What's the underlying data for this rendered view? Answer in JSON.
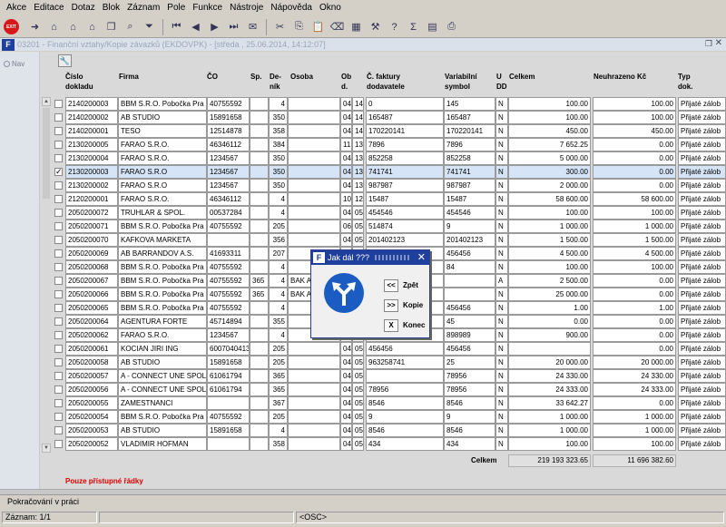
{
  "menu": [
    "Akce",
    "Editace",
    "Dotaz",
    "Blok",
    "Záznam",
    "Pole",
    "Funkce",
    "Nástroje",
    "Nápověda",
    "Okno"
  ],
  "toolbar": {
    "exit_label": "EXIT"
  },
  "window": {
    "title": "03201 - Finanční vztahy/Kopie závazků (EKDOVPK) - [středa , 25.06.2014, 14:12:07]"
  },
  "nav": {
    "label": "Nav"
  },
  "columns": {
    "cislo": [
      "Číslo",
      "dokladu"
    ],
    "firma": "Firma",
    "co": "ČO",
    "sp": "Sp.",
    "denik": [
      "De-",
      "ník"
    ],
    "osoba": "Osoba",
    "obd": [
      "Ob",
      "d."
    ],
    "faktura": [
      "Č. faktury",
      "dodavatele"
    ],
    "vs": [
      "Variabilní",
      "symbol"
    ],
    "udd": [
      "U",
      "DD"
    ],
    "celkem": "Celkem",
    "neuhrazeno": "Neuhrazeno Kč",
    "typ": [
      "Typ",
      "dok."
    ]
  },
  "rows": [
    {
      "c": "2140200003",
      "f": "BBM S.R.O. Pobočka Pra",
      "ico": "40755592",
      "sp": "",
      "d": "4",
      "o": "",
      "m": "04",
      "y": "14",
      "fak": "0",
      "vs": "145",
      "u": "N",
      "cel": "100.00",
      "neu": "100.00",
      "t": "Přijaté zálob"
    },
    {
      "c": "2140200002",
      "f": "AB STUDIO",
      "ico": "15891658",
      "sp": "",
      "d": "350",
      "o": "",
      "m": "04",
      "y": "14",
      "fak": "165487",
      "vs": "165487",
      "u": "N",
      "cel": "100.00",
      "neu": "100.00",
      "t": "Přijaté zálob"
    },
    {
      "c": "2140200001",
      "f": "TESO",
      "ico": "12514878",
      "sp": "",
      "d": "358",
      "o": "",
      "m": "04",
      "y": "14",
      "fak": "170220141",
      "vs": "170220141",
      "u": "N",
      "cel": "450.00",
      "neu": "450.00",
      "t": "Přijaté zálob"
    },
    {
      "c": "2130200005",
      "f": "FARAO S.R.O.",
      "ico": "46346112",
      "sp": "",
      "d": "384",
      "o": "",
      "m": "11",
      "y": "13",
      "fak": "7896",
      "vs": "7896",
      "u": "N",
      "cel": "7 652.25",
      "neu": "0.00",
      "t": "Přijaté zálob"
    },
    {
      "c": "2130200004",
      "f": "FARAO S.R.O.",
      "ico": "1234567",
      "sp": "",
      "d": "350",
      "o": "",
      "m": "04",
      "y": "13",
      "fak": "852258",
      "vs": "852258",
      "u": "N",
      "cel": "5 000.00",
      "neu": "0.00",
      "t": "Přijaté zálob"
    },
    {
      "c": "2130200003",
      "f": "FARAO S.R.O",
      "ico": "1234567",
      "sp": "",
      "d": "350",
      "o": "",
      "m": "04",
      "y": "13",
      "fak": "741741",
      "vs": "741741",
      "u": "N",
      "cel": "300.00",
      "neu": "0.00",
      "t": "Přijaté zálob",
      "sel": true
    },
    {
      "c": "2130200002",
      "f": "FARAO S.R.O",
      "ico": "1234567",
      "sp": "",
      "d": "350",
      "o": "",
      "m": "04",
      "y": "13",
      "fak": "987987",
      "vs": "987987",
      "u": "N",
      "cel": "2 000.00",
      "neu": "0.00",
      "t": "Přijaté zálob"
    },
    {
      "c": "2120200001",
      "f": "FARAO S.R.O.",
      "ico": "46346112",
      "sp": "",
      "d": "4",
      "o": "",
      "m": "10",
      "y": "12",
      "fak": "15487",
      "vs": "15487",
      "u": "N",
      "cel": "58 600.00",
      "neu": "58 600.00",
      "t": "Přijaté zálob"
    },
    {
      "c": "2050200072",
      "f": "TRUHLAR & SPOL.",
      "ico": "00537284",
      "sp": "",
      "d": "4",
      "o": "",
      "m": "04",
      "y": "05",
      "fak": "454546",
      "vs": "454546",
      "u": "N",
      "cel": "100.00",
      "neu": "100.00",
      "t": "Přijaté zálob"
    },
    {
      "c": "2050200071",
      "f": "BBM S.R.O. Pobočka Pra",
      "ico": "40755592",
      "sp": "",
      "d": "205",
      "o": "",
      "m": "06",
      "y": "05",
      "fak": "514874",
      "vs": "9",
      "u": "N",
      "cel": "1 000.00",
      "neu": "1 000.00",
      "t": "Přijaté zálob"
    },
    {
      "c": "2050200070",
      "f": "KAFKOVA MARKETA",
      "ico": "",
      "sp": "",
      "d": "356",
      "o": "",
      "m": "04",
      "y": "05",
      "fak": "201402123",
      "vs": "201402123",
      "u": "N",
      "cel": "1 500.00",
      "neu": "1 500.00",
      "t": "Přijaté zálob"
    },
    {
      "c": "2050200069",
      "f": "AB BARRANDOV A.S.",
      "ico": "41693311",
      "sp": "",
      "d": "207",
      "o": "",
      "m": "",
      "y": "",
      "fak": "",
      "vs": "456456",
      "u": "N",
      "cel": "4 500.00",
      "neu": "4 500.00",
      "t": "Přijaté zálob"
    },
    {
      "c": "2050200068",
      "f": "BBM S.R.O. Pobočka Pra",
      "ico": "40755592",
      "sp": "",
      "d": "4",
      "o": "",
      "m": "",
      "y": "",
      "fak": "",
      "vs": "84",
      "u": "N",
      "cel": "100.00",
      "neu": "100.00",
      "t": "Přijaté zálob"
    },
    {
      "c": "2050200067",
      "f": "BBM S.R.O. Pobočka Pra",
      "ico": "40755592",
      "sp": "365",
      "d": "4",
      "o": "BAK A",
      "m": "",
      "y": "",
      "fak": "",
      "vs": "",
      "u": "A",
      "cel": "2 500.00",
      "neu": "0.00",
      "t": "Přijaté zálob"
    },
    {
      "c": "2050200066",
      "f": "BBM S.R.O. Pobočka Pra",
      "ico": "40755592",
      "sp": "365",
      "d": "4",
      "o": "BAK A",
      "m": "",
      "y": "",
      "fak": "",
      "vs": "",
      "u": "N",
      "cel": "25 000.00",
      "neu": "0.00",
      "t": "Přijaté zálob"
    },
    {
      "c": "2050200065",
      "f": "BBM S.R.O. Pobočka Pra",
      "ico": "40755592",
      "sp": "",
      "d": "4",
      "o": "",
      "m": "",
      "y": "",
      "fak": "",
      "vs": "456456",
      "u": "N",
      "cel": "1.00",
      "neu": "1.00",
      "t": "Přijaté zálob"
    },
    {
      "c": "2050200064",
      "f": "AGENTURA FORTE",
      "ico": "45714894",
      "sp": "",
      "d": "355",
      "o": "",
      "m": "",
      "y": "",
      "fak": "",
      "vs": "45",
      "u": "N",
      "cel": "0.00",
      "neu": "0.00",
      "t": "Přijaté zálob"
    },
    {
      "c": "2050200062",
      "f": "FARAO S.R.O.",
      "ico": "1234567",
      "sp": "",
      "d": "4",
      "o": "",
      "m": "",
      "y": "",
      "fak": "",
      "vs": "898989",
      "u": "N",
      "cel": "900.00",
      "neu": "0.00",
      "t": "Přijaté zálob"
    },
    {
      "c": "2050200061",
      "f": "KOCIAN JIRI ING",
      "ico": "6007040413",
      "sp": "",
      "d": "205",
      "o": "",
      "m": "04",
      "y": "05",
      "fak": "456456",
      "vs": "456456",
      "u": "N",
      "cel": "",
      "neu": "0.00",
      "t": "Přijaté zálob"
    },
    {
      "c": "2050200058",
      "f": "AB STUDIO",
      "ico": "15891658",
      "sp": "",
      "d": "205",
      "o": "",
      "m": "04",
      "y": "05",
      "fak": "963258741",
      "vs": "25",
      "u": "N",
      "cel": "20 000.00",
      "neu": "20 000.00",
      "t": "Přijaté zálob"
    },
    {
      "c": "2050200057",
      "f": "A - CONNECT UNE SPOL",
      "ico": "61061794",
      "sp": "",
      "d": "365",
      "o": "",
      "m": "04",
      "y": "05",
      "fak": "",
      "vs": "78956",
      "u": "N",
      "cel": "24 330.00",
      "neu": "24 330.00",
      "t": "Přijaté zálob"
    },
    {
      "c": "2050200056",
      "f": "A - CONNECT UNE SPOL",
      "ico": "61061794",
      "sp": "",
      "d": "365",
      "o": "",
      "m": "04",
      "y": "05",
      "fak": "78956",
      "vs": "78956",
      "u": "N",
      "cel": "24 333.00",
      "neu": "24 333.00",
      "t": "Přijaté zálob"
    },
    {
      "c": "2050200055",
      "f": "ZAMESTNANCI",
      "ico": "",
      "sp": "",
      "d": "367",
      "o": "",
      "m": "04",
      "y": "05",
      "fak": "8546",
      "vs": "8546",
      "u": "N",
      "cel": "33 642.27",
      "neu": "0.00",
      "t": "Přijaté zálob"
    },
    {
      "c": "2050200054",
      "f": "BBM S.R.O. Pobočka Pra",
      "ico": "40755592",
      "sp": "",
      "d": "205",
      "o": "",
      "m": "04",
      "y": "05",
      "fak": "9",
      "vs": "9",
      "u": "N",
      "cel": "1 000.00",
      "neu": "1 000.00",
      "t": "Přijaté zálob"
    },
    {
      "c": "2050200053",
      "f": "AB STUDIO",
      "ico": "15891658",
      "sp": "",
      "d": "4",
      "o": "",
      "m": "04",
      "y": "05",
      "fak": "8546",
      "vs": "8546",
      "u": "N",
      "cel": "1 000.00",
      "neu": "1 000.00",
      "t": "Přijaté zálob"
    },
    {
      "c": "2050200052",
      "f": "VLADIMIR HOFMAN",
      "ico": "",
      "sp": "",
      "d": "358",
      "o": "",
      "m": "04",
      "y": "05",
      "fak": "434",
      "vs": "434",
      "u": "N",
      "cel": "100.00",
      "neu": "100.00",
      "t": "Přijaté zálob"
    }
  ],
  "totals": {
    "label": "Celkem",
    "celkem": "219 193 323.65",
    "neuhrazeno": "11 696 382.60"
  },
  "note": "Pouze přístupné řádky",
  "status": {
    "message": "Pokračování v práci",
    "record": "Záznam: 1/1",
    "mode": "<OSC>"
  },
  "dialog": {
    "title": "Jak dál ???",
    "back_icon": "<<",
    "back_label": "Zpět",
    "copy_icon": ">>",
    "copy_label": "Kopie",
    "end_icon": "X",
    "end_label": "Konec"
  }
}
